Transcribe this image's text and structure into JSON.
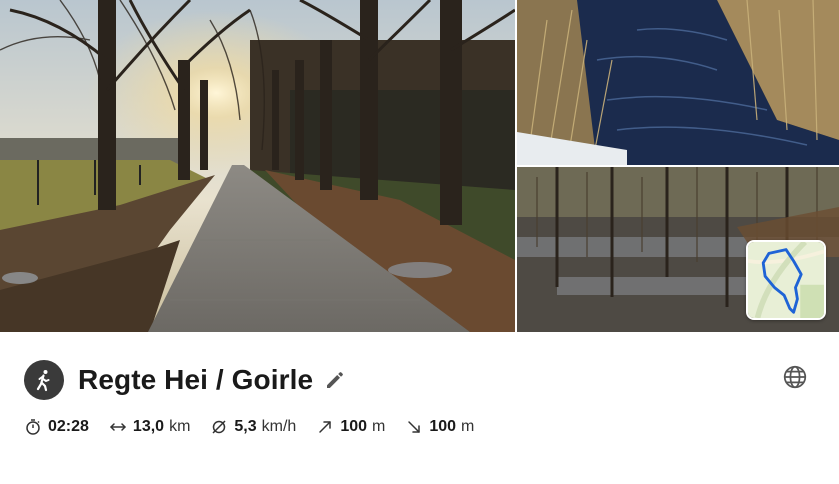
{
  "tour": {
    "title": "Regte Hei / Goirle",
    "activity_icon": "hiking-icon",
    "edit_icon": "pencil-icon",
    "language_icon": "globe-icon"
  },
  "stats": [
    {
      "icon": "stopwatch-icon",
      "value": "02:28",
      "unit": ""
    },
    {
      "icon": "distance-arrows-icon",
      "value": "13,0",
      "unit": "km"
    },
    {
      "icon": "average-speed-icon",
      "value": "5,3",
      "unit": "km/h"
    },
    {
      "icon": "ascent-arrow-icon",
      "value": "100",
      "unit": "m"
    },
    {
      "icon": "descent-arrow-icon",
      "value": "100",
      "unit": "m"
    }
  ],
  "colors": {
    "title": "#1a1a1a",
    "activity_badge": "#3a3a3a",
    "route_line": "#1e63d6",
    "icon_grey": "#555555"
  }
}
